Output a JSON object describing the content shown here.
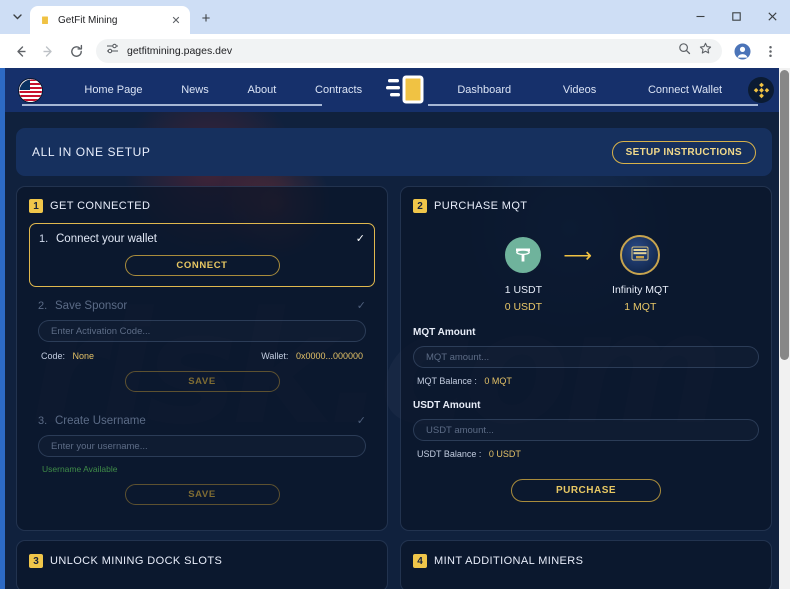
{
  "browser": {
    "tab": {
      "title": "GetFit Mining",
      "favicon_icon": "getfit-favicon",
      "close_icon": "close-icon"
    },
    "tab_list_chevron_icon": "chevron-down-icon",
    "new_tab_icon": "plus-icon",
    "window_controls": {
      "minimize_icon": "minimize-icon",
      "maximize_icon": "maximize-icon",
      "close_icon": "close-icon"
    },
    "nav": {
      "back_icon": "arrow-left-icon",
      "forward_icon": "arrow-right-icon",
      "reload_icon": "reload-icon"
    },
    "omnibox": {
      "site_info_icon": "tune-icon",
      "url": "getfitmining.pages.dev",
      "zoom_icon": "search-icon",
      "bookmark_icon": "star-icon",
      "profile_icon": "avatar-icon",
      "menu_icon": "kebab-menu-icon"
    }
  },
  "site_nav": {
    "flag_icon": "us-flag-icon",
    "logo_icon": "getfit-logo-icon",
    "wallet_chain_icon": "binance-bnb-icon",
    "left_links": [
      "Home Page",
      "News",
      "About",
      "Contracts"
    ],
    "right_links": [
      "Dashboard",
      "Videos",
      "Connect Wallet"
    ]
  },
  "banner": {
    "title": "ALL IN ONE SETUP",
    "button": "SETUP INSTRUCTIONS"
  },
  "card_get_connected": {
    "number": "1",
    "title": "GET CONNECTED",
    "steps": [
      {
        "num": "1.",
        "label": "Connect your wallet",
        "check": "✓",
        "button": "CONNECT"
      },
      {
        "num": "2.",
        "label": "Save Sponsor",
        "check": "✓",
        "input_placeholder": "Enter Activation Code...",
        "code_key": "Code:",
        "code_value": "None",
        "wallet_key": "Wallet:",
        "wallet_value": "0x0000...000000",
        "button": "SAVE"
      },
      {
        "num": "3.",
        "label": "Create Username",
        "check": "✓",
        "input_placeholder": "Enter your username...",
        "availability": "Username Available",
        "button": "SAVE"
      }
    ]
  },
  "card_purchase": {
    "number": "2",
    "title": "PURCHASE MQT",
    "swap": {
      "from_icon": "usdt-token-icon",
      "arrow_icon": "arrow-right-icon",
      "to_icon": "mqt-token-icon",
      "from_rate": "1  USDT",
      "from_balance": "0  USDT",
      "to_rate": "Infinity  MQT",
      "to_balance": "1  MQT"
    },
    "mqt_label": "MQT Amount",
    "mqt_placeholder": "MQT amount...",
    "mqt_balance_key": "MQT Balance :",
    "mqt_balance_value": "0 MQT",
    "usdt_label": "USDT Amount",
    "usdt_placeholder": "USDT amount...",
    "usdt_balance_key": "USDT Balance :",
    "usdt_balance_value": "0 USDT",
    "button": "PURCHASE"
  },
  "card_unlock": {
    "number": "3",
    "title": "UNLOCK MINING DOCK SLOTS"
  },
  "card_mint": {
    "number": "4",
    "title": "MINT ADDITIONAL MINERS"
  },
  "watermark": "risk.com",
  "colors": {
    "accent_gold": "#e0b84e",
    "nav_blue": "#16306b",
    "page_bg": "#10213d",
    "card_bg": "#0a1528",
    "available_green": "#3f8c48"
  }
}
